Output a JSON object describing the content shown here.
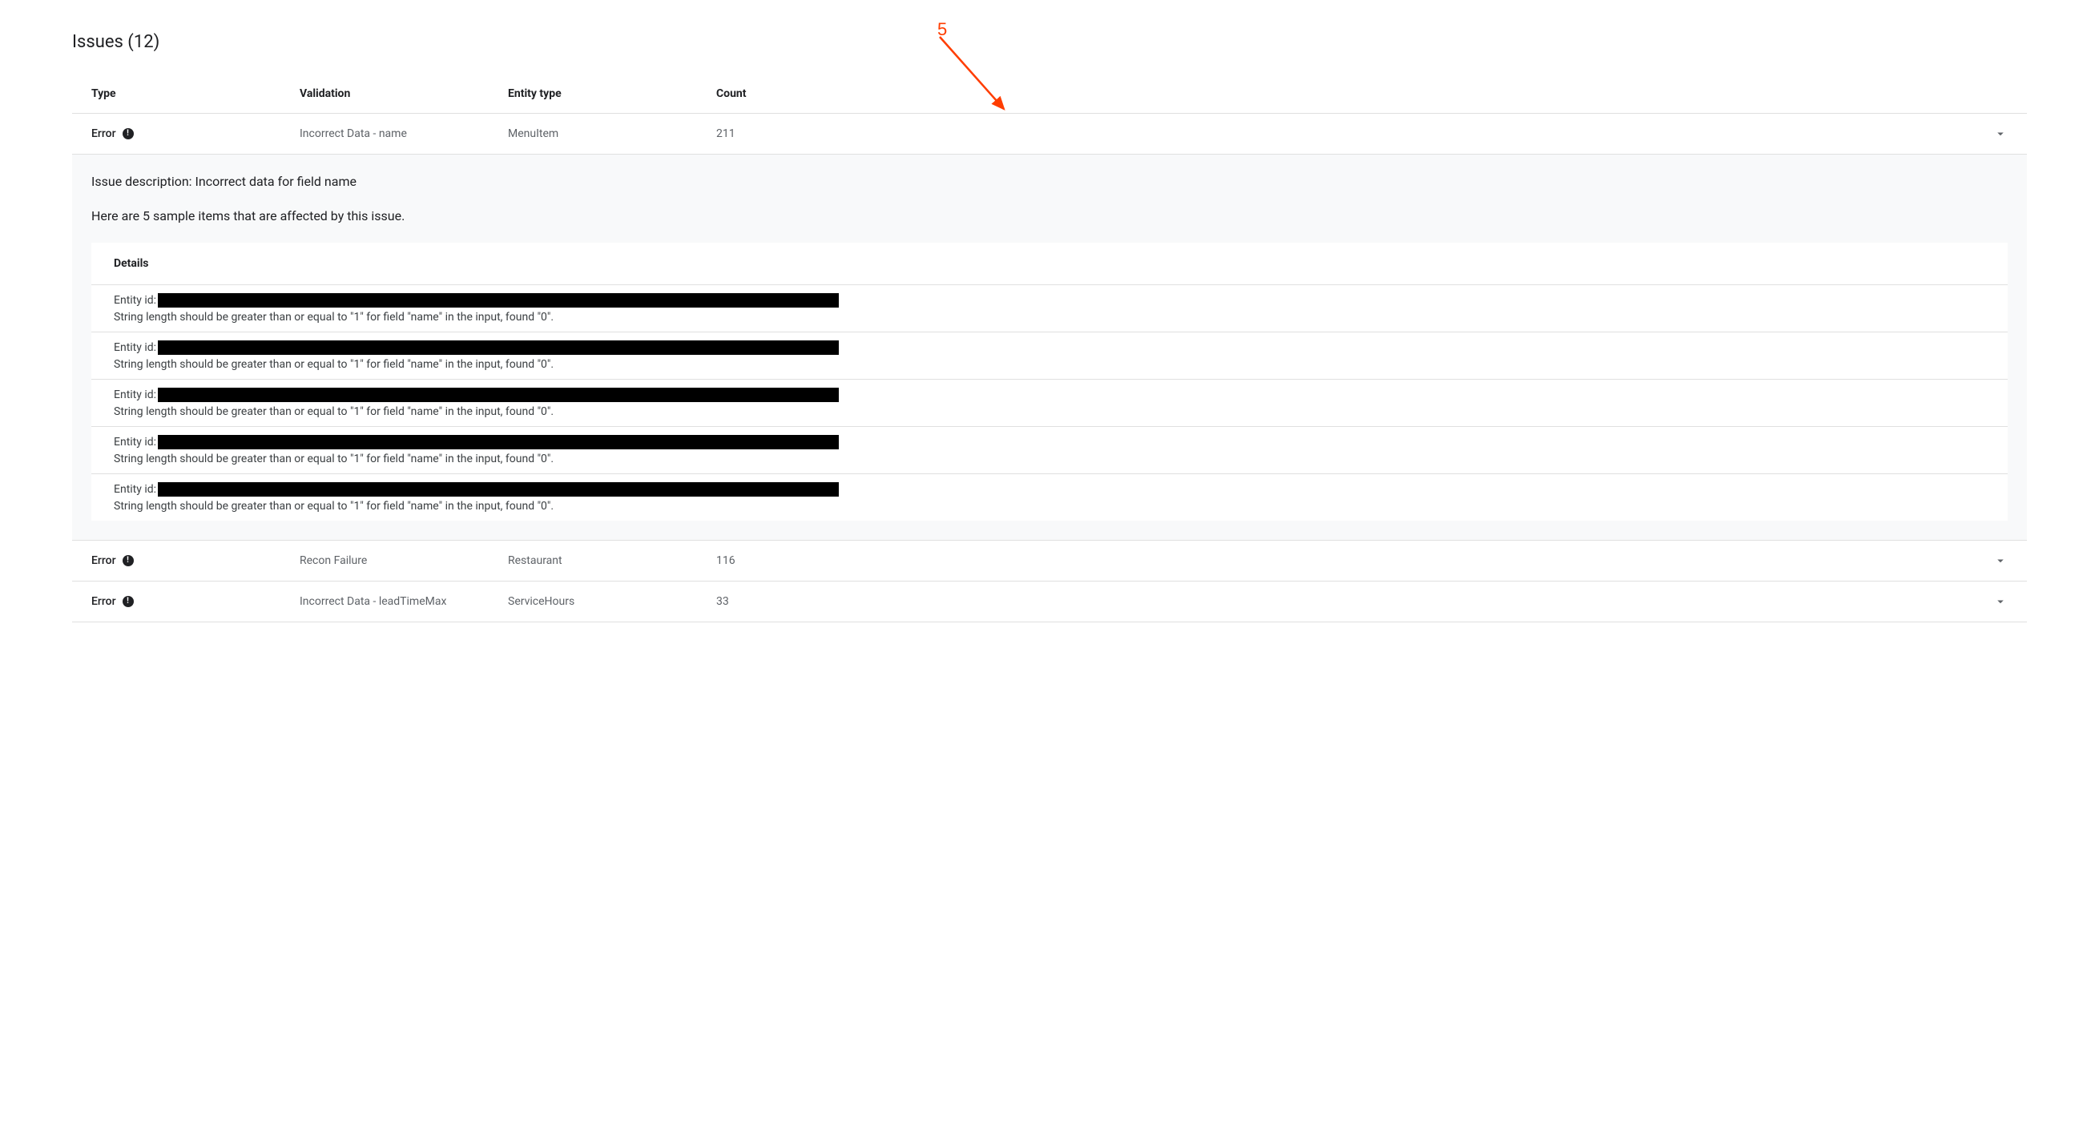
{
  "page": {
    "title_prefix": "Issues",
    "count": "12"
  },
  "headers": {
    "type": "Type",
    "validation": "Validation",
    "entity_type": "Entity type",
    "count": "Count"
  },
  "rows": [
    {
      "type_label": "Error",
      "validation": "Incorrect Data - name",
      "entity_type": "MenuItem",
      "count": "211",
      "expanded": true,
      "panel": {
        "description": "Issue description: Incorrect data for field name",
        "samples_intro": "Here are 5 sample items that are affected by this issue.",
        "details_heading": "Details",
        "entity_id_label": "Entity id:",
        "details": [
          {
            "message": "String length should be greater than or equal to \"1\" for field \"name\" in the input, found \"0\"."
          },
          {
            "message": "String length should be greater than or equal to \"1\" for field \"name\" in the input, found \"0\"."
          },
          {
            "message": "String length should be greater than or equal to \"1\" for field \"name\" in the input, found \"0\"."
          },
          {
            "message": "String length should be greater than or equal to \"1\" for field \"name\" in the input, found \"0\"."
          },
          {
            "message": "String length should be greater than or equal to \"1\" for field \"name\" in the input, found \"0\"."
          }
        ]
      }
    },
    {
      "type_label": "Error",
      "validation": "Recon Failure",
      "entity_type": "Restaurant",
      "count": "116",
      "expanded": false
    },
    {
      "type_label": "Error",
      "validation": "Incorrect Data - leadTimeMax",
      "entity_type": "ServiceHours",
      "count": "33",
      "expanded": false
    }
  ],
  "annotation": {
    "label": "5"
  }
}
